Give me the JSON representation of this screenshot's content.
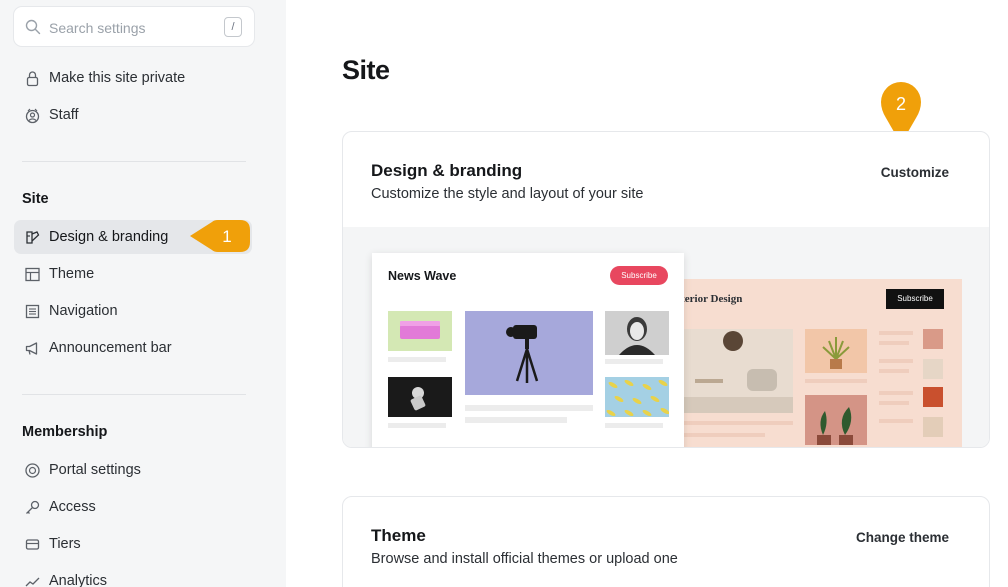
{
  "sidebar": {
    "search": {
      "placeholder": "Search settings",
      "shortcut": "/"
    },
    "general_items": [
      {
        "label": "Make this site private",
        "icon": "lock-icon"
      },
      {
        "label": "Staff",
        "icon": "staff-icon"
      }
    ],
    "site_section": {
      "title": "Site",
      "items": [
        {
          "label": "Design & branding",
          "icon": "paintbrush-icon",
          "active": true
        },
        {
          "label": "Theme",
          "icon": "layout-icon"
        },
        {
          "label": "Navigation",
          "icon": "list-icon"
        },
        {
          "label": "Announcement bar",
          "icon": "megaphone-icon"
        }
      ]
    },
    "membership_section": {
      "title": "Membership",
      "items": [
        {
          "label": "Portal settings",
          "icon": "portal-icon"
        },
        {
          "label": "Access",
          "icon": "key-icon"
        },
        {
          "label": "Tiers",
          "icon": "tiers-icon"
        },
        {
          "label": "Analytics",
          "icon": "analytics-icon"
        }
      ]
    }
  },
  "callouts": {
    "first": "1",
    "second": "2",
    "color": "#f0a00a"
  },
  "main": {
    "title": "Site",
    "design_card": {
      "title": "Design & branding",
      "description": "Customize the style and layout of your site",
      "action": "Customize",
      "preview": {
        "theme_one": {
          "brand": "News Wave",
          "button": "Subscribe",
          "button_color": "#e8475f"
        },
        "theme_two": {
          "brand": "nterior Design",
          "button": "Subscribe"
        }
      }
    },
    "theme_card": {
      "title": "Theme",
      "description": "Browse and install official themes or upload one",
      "action": "Change theme"
    }
  }
}
